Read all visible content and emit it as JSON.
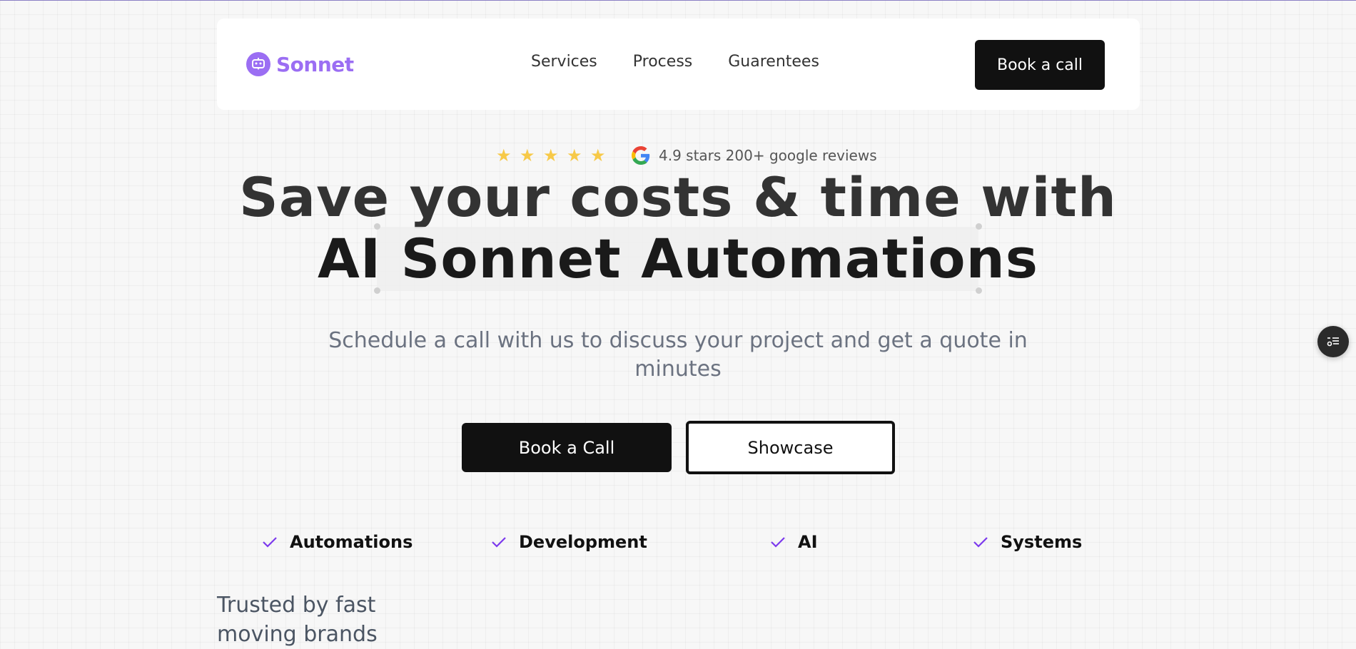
{
  "brand": {
    "name": "Sonnet",
    "color": "#9b6ef3"
  },
  "nav": {
    "links": [
      "Services",
      "Process",
      "Guarentees"
    ],
    "cta": "Book a call"
  },
  "rating": {
    "stars": 5,
    "text": "4.9 stars 200+ google reviews",
    "star_color": "#f7c948"
  },
  "hero": {
    "line1": "Save your costs & time with",
    "line2": "AI Sonnet Automations",
    "subtitle": "Schedule a call with us to discuss your project and get a quote in minutes"
  },
  "buttons": {
    "primary": "Book a Call",
    "secondary": "Showcase"
  },
  "features": [
    "Automations",
    "Development",
    "AI",
    "Systems"
  ],
  "check_color": "#7c3aed",
  "trusted": "Trusted by fast moving brands",
  "icons": {
    "logo": "robot-chat-icon",
    "star": "star-icon",
    "google": "google-icon",
    "check": "check-icon",
    "widget": "settings-list-icon"
  }
}
